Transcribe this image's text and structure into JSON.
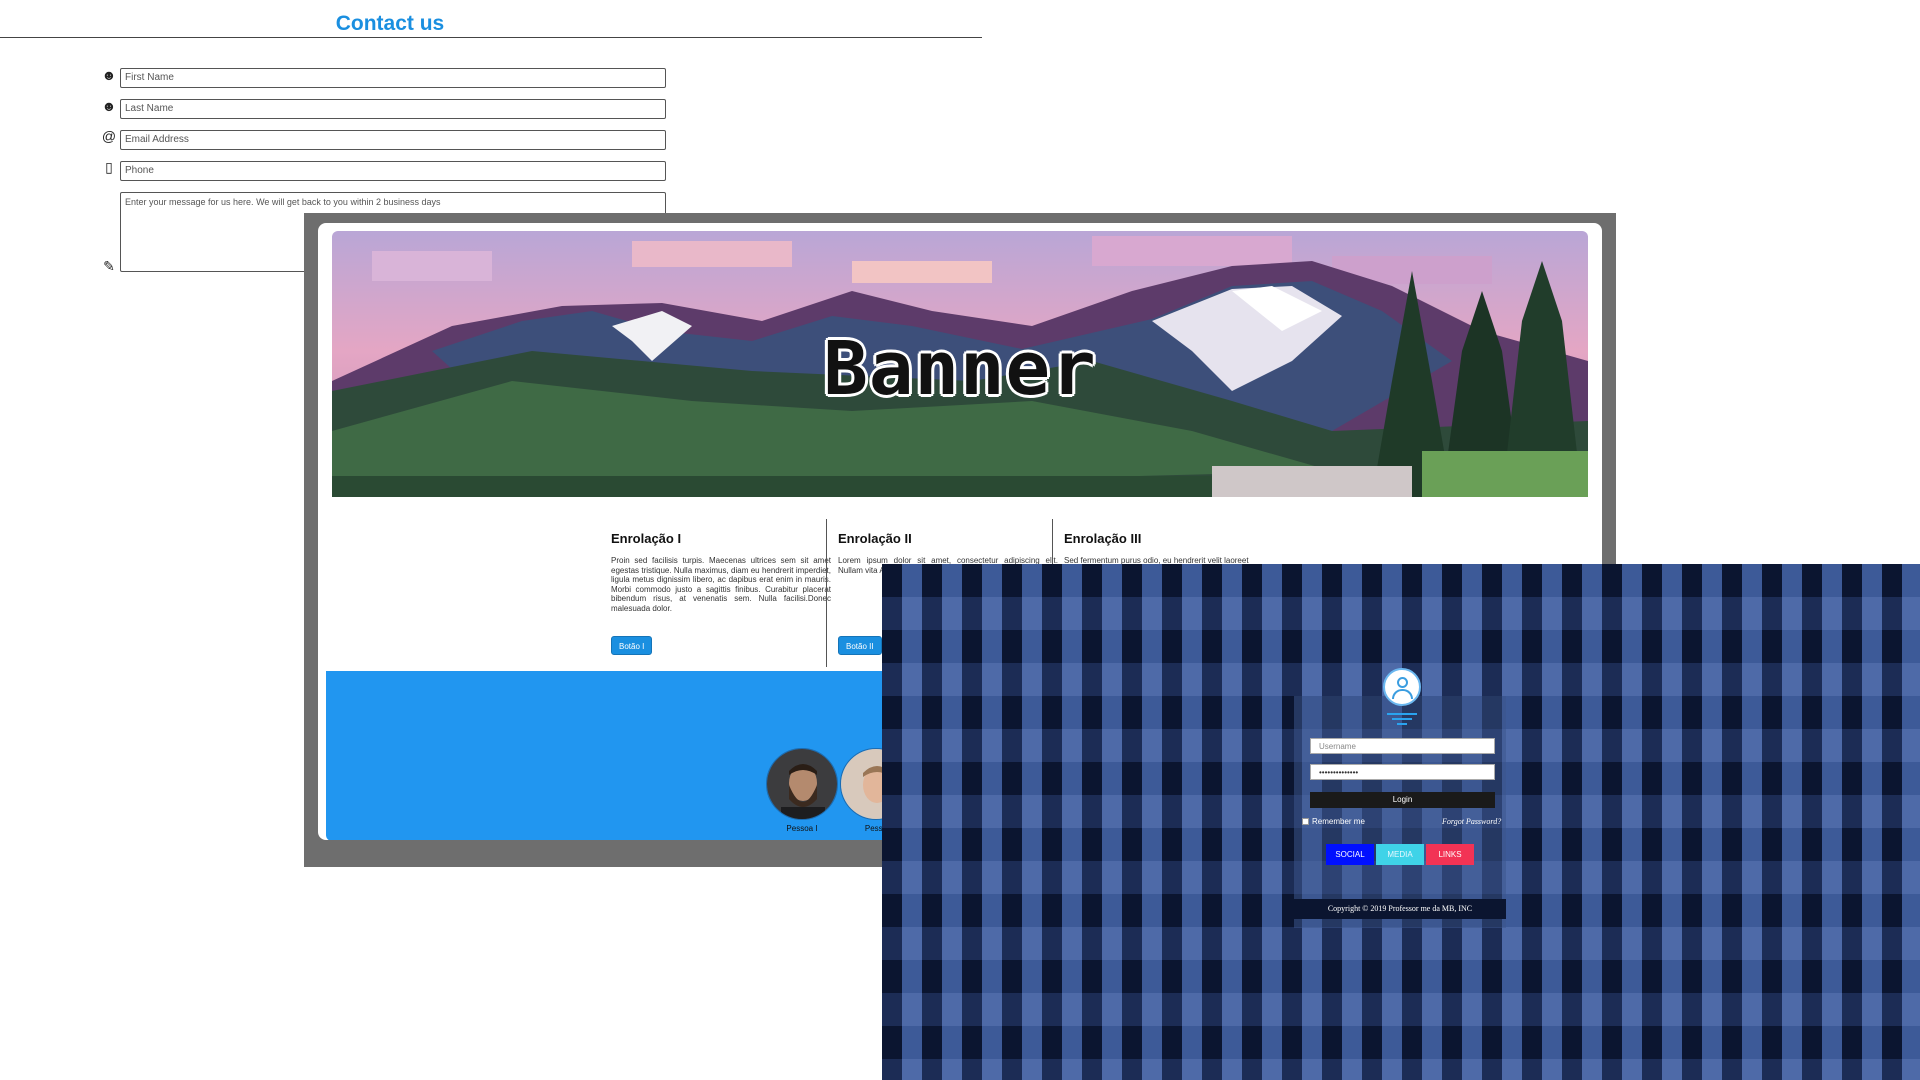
{
  "contact": {
    "title": "Contact us",
    "fields": {
      "first_name_placeholder": "First Name",
      "last_name_placeholder": "Last Name",
      "email_placeholder": "Email Address",
      "phone_placeholder": "Phone",
      "message_placeholder": "Enter your message for us here. We will get back to you within 2 business days"
    },
    "icons": [
      "person-icon",
      "person-icon",
      "at-icon",
      "phone-icon",
      "pencil-icon"
    ]
  },
  "banner_page": {
    "banner_title": "Banner",
    "columns": [
      {
        "title": "Enrolação I",
        "text": "Proin sed facilisis turpis. Maecenas ultrices sem sit amet egestas tristique. Nulla maximus, diam eu hendrerit imperdiet, ligula metus dignissim libero, ac dapibus erat enim in mauris. Morbi commodo justo a sagittis finibus. Curabitur placerat bibendum risus, at venenatis sem. Nulla facilisi.Donec malesuada dolor.",
        "button": "Botão I"
      },
      {
        "title": "Enrolação II",
        "text": "Lorem ipsum dolor sit amet, consectetur adipiscing elit. Nullam vita Aliquam a Suspendisse pulvinar m",
        "button": "Botão II"
      },
      {
        "title": "Enrolação III",
        "text": "Sed fermentum purus odio, eu hendrerit velit laoreet"
      }
    ],
    "people": [
      {
        "name": "Pessoa I"
      },
      {
        "name": "Pesso"
      }
    ]
  },
  "login": {
    "username_placeholder": "Username",
    "password_value": "••••••••••••••",
    "login_button": "Login",
    "remember_label": "Remember me",
    "forgot_link": "Forgot Password?",
    "social_buttons": [
      "SOCIAL",
      "MEDIA",
      "LINKS"
    ],
    "copyright": "Copyright © 2019 Professor me da MB, INC"
  },
  "colors": {
    "accent_blue": "#1a8fe0",
    "section_blue": "#2196f0",
    "social": "#0010ff",
    "media": "#3fd3e8",
    "links": "#f23355"
  }
}
